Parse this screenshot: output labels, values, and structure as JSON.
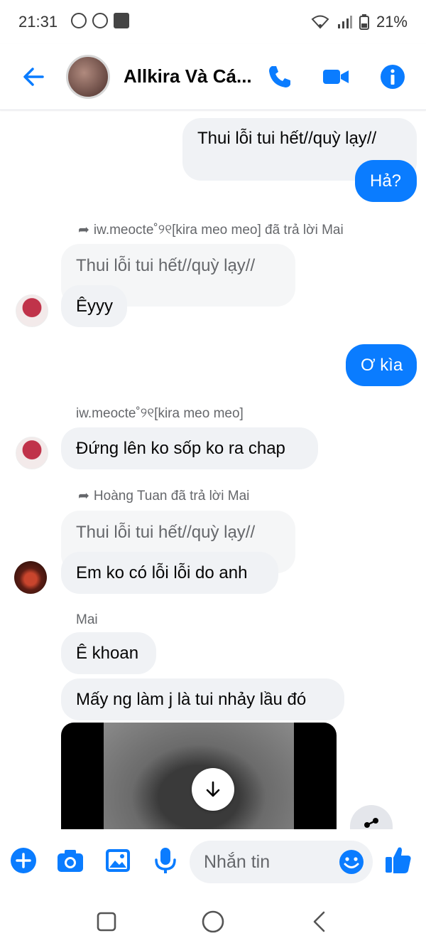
{
  "status_bar": {
    "time": "21:31",
    "battery": "21%"
  },
  "header": {
    "title": "Allkira Và Cá...",
    "icons": [
      "back-arrow-icon",
      "phone-icon",
      "video-camera-icon",
      "info-icon"
    ]
  },
  "colors": {
    "accent": "#0a7cff",
    "incoming_bubble": "#f0f2f5",
    "meta_text": "#65676b"
  },
  "messages": {
    "m1_in_text": "Thui lỗi tui hết//quỳ lạy//",
    "m2_out_text": "Hả?",
    "m3_meta": "iw.meocte˚୨୧[kira meo meo] đã trả lời Mai",
    "m3_quoted": "Thui lỗi tui hết//quỳ lạy//",
    "m3_text": "Êyyy",
    "m4_out_text": "Ơ kìa",
    "m5_meta": "iw.meocte˚୨୧[kira meo meo]",
    "m5_text": "Đứng lên ko sốp ko ra chap",
    "m6_meta": "Hoàng Tuan đã trả lời Mai",
    "m6_quoted": "Thui lỗi tui hết//quỳ lạy//",
    "m6_text": "Em ko có lỗi lỗi do anh",
    "m7_sender": "Mai",
    "m7_text1": "Ê khoan",
    "m7_text2": "Mấy ng làm j là tui nhảy lầu đó"
  },
  "composer": {
    "placeholder": "Nhắn tin",
    "icons": [
      "plus-icon",
      "camera-icon",
      "gallery-icon",
      "microphone-icon",
      "emoji-icon",
      "thumbs-up-icon"
    ]
  }
}
